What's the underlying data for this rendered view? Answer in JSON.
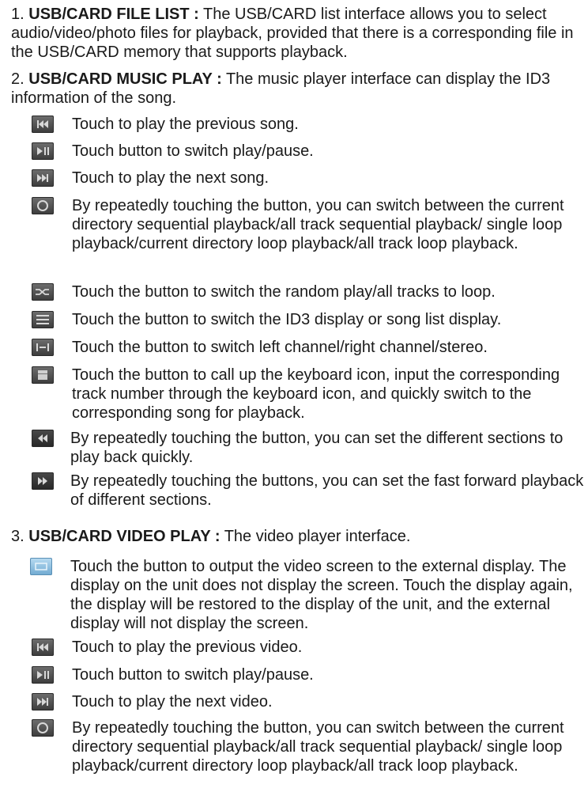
{
  "section1": {
    "number": "1.",
    "title": "USB/CARD FILE LIST :",
    "text": "The USB/CARD list interface allows you to select audio/video/photo files for playback, provided that there is a corresponding file in the USB/CARD memory that supports playback."
  },
  "section2": {
    "number": "2.",
    "title": "USB/CARD MUSIC PLAY :",
    "text": "The music player interface can display the ID3 information of the song.",
    "items": [
      {
        "icon": "previous-track-icon",
        "text": "Touch to play the previous song."
      },
      {
        "icon": "play-pause-icon",
        "text": "Touch button to switch play/pause."
      },
      {
        "icon": "next-track-icon",
        "text": "Touch to play the next song."
      },
      {
        "icon": "repeat-icon",
        "text": "By repeatedly touching the button, you can switch between the current directory sequential playback/all track sequential playback/ single loop playback/current directory loop playback/all track loop playback."
      },
      {
        "icon": "shuffle-icon",
        "text": "Touch the button to switch the random play/all tracks to loop."
      },
      {
        "icon": "list-icon",
        "text": "Touch the button to switch the ID3 display or song list display."
      },
      {
        "icon": "channel-icon",
        "text": "Touch the button to switch left channel/right channel/stereo."
      },
      {
        "icon": "keypad-icon",
        "text": "Touch the button to call up the keyboard icon, input the corresponding track number through the keyboard icon, and quickly switch to the corresponding song for playback."
      },
      {
        "icon": "fast-rewind-icon",
        "text": "By repeatedly touching the button, you can set the different sections to play back quickly."
      },
      {
        "icon": "fast-forward-icon",
        "text": "By repeatedly touching the buttons, you can set the fast forward playback of different sections."
      }
    ]
  },
  "section3": {
    "number": "3.",
    "title": "USB/CARD VIDEO PLAY :",
    "text": "The video player interface.",
    "items": [
      {
        "icon": "external-display-icon",
        "text": "Touch the button to output the video screen to the external display. The display on the unit does not display the screen. Touch the display again, the display will be restored to the display of the unit, and the external display will not display the screen."
      },
      {
        "icon": "previous-track-icon",
        "text": "Touch to play the previous video."
      },
      {
        "icon": "play-pause-icon",
        "text": "Touch button to switch play/pause."
      },
      {
        "icon": "next-track-icon",
        "text": "Touch to play the next video."
      },
      {
        "icon": "repeat-icon",
        "text": "By repeatedly touching the button, you can switch between the current directory sequential playback/all track sequential playback/ single loop playback/current directory loop playback/all track loop playback."
      }
    ]
  }
}
